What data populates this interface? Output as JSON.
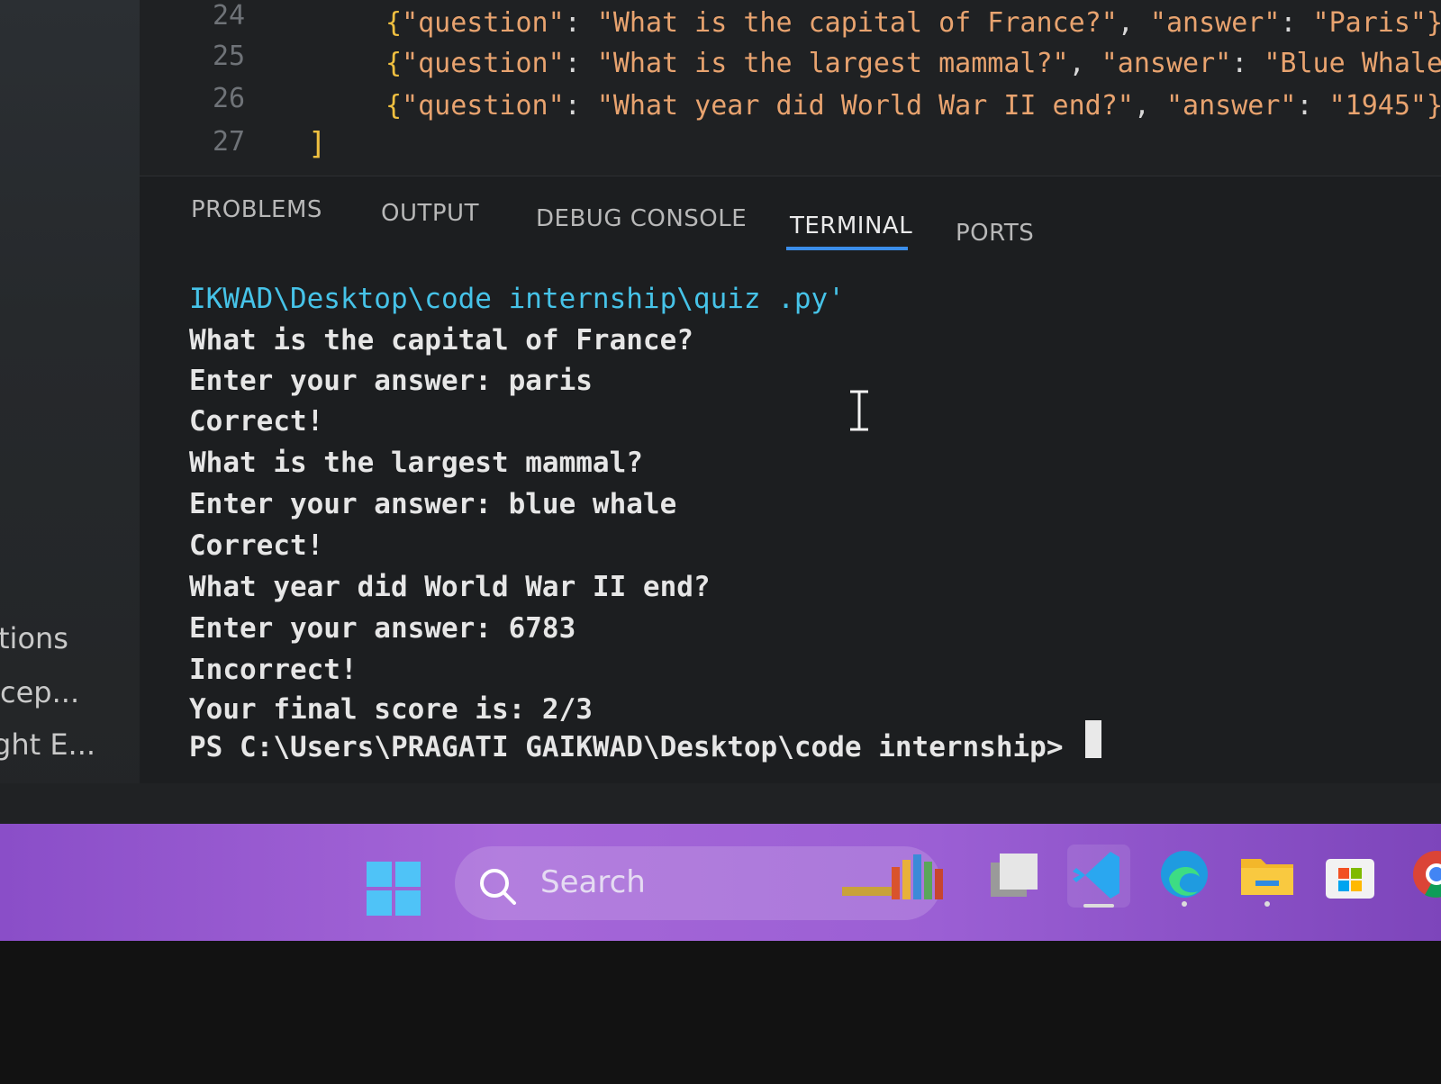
{
  "editor": {
    "line_numbers": [
      "24",
      "25",
      "26",
      "27"
    ],
    "code_lines": [
      {
        "open": "{",
        "key": "\"question\"",
        "colon": ": ",
        "question": "\"What is the capital of France?\"",
        "sep": ", ",
        "akey": "\"answer\"",
        "acolon": ": ",
        "answer": "\"Paris\"}"
      },
      {
        "open": "{",
        "key": "\"question\"",
        "colon": ": ",
        "question": "\"What is the largest mammal?\"",
        "sep": ", ",
        "akey": "\"answer\"",
        "acolon": ": ",
        "answer": "\"Blue Whale"
      },
      {
        "open": "{",
        "key": "\"question\"",
        "colon": ": ",
        "question": "\"What year did World War II end?\"",
        "sep": ", ",
        "akey": "\"answer\"",
        "acolon": ": ",
        "answer": "\"1945\"}"
      }
    ],
    "closing_bracket": "]"
  },
  "panel": {
    "tabs": [
      {
        "label": "PROBLEMS"
      },
      {
        "label": "OUTPUT"
      },
      {
        "label": "DEBUG CONSOLE"
      },
      {
        "label": "TERMINAL"
      },
      {
        "label": "PORTS"
      }
    ],
    "active_tab": "TERMINAL"
  },
  "terminal": {
    "lines": [
      "IKWAD\\Desktop\\code internship\\quiz .py'",
      "What is the capital of France?",
      "Enter your answer: paris",
      "Correct!",
      "What is the largest mammal?",
      "Enter your answer: blue whale",
      "Correct!",
      "What year did World War II end?",
      "Enter your answer: 6783",
      "Incorrect!",
      "Your final score is: 2/3",
      "PS C:\\Users\\PRAGATI GAIKWAD\\Desktop\\code internship>"
    ]
  },
  "sidebar": {
    "items": [
      "tions",
      "cep...",
      "ght E..."
    ]
  },
  "taskbar": {
    "search_label": "Search",
    "accent": "#9b5fd4"
  },
  "colors": {
    "path_text": "#46c3e8",
    "string": "#e8a36f",
    "brace": "#f0c040",
    "active_tab_underline": "#3b8eea"
  }
}
